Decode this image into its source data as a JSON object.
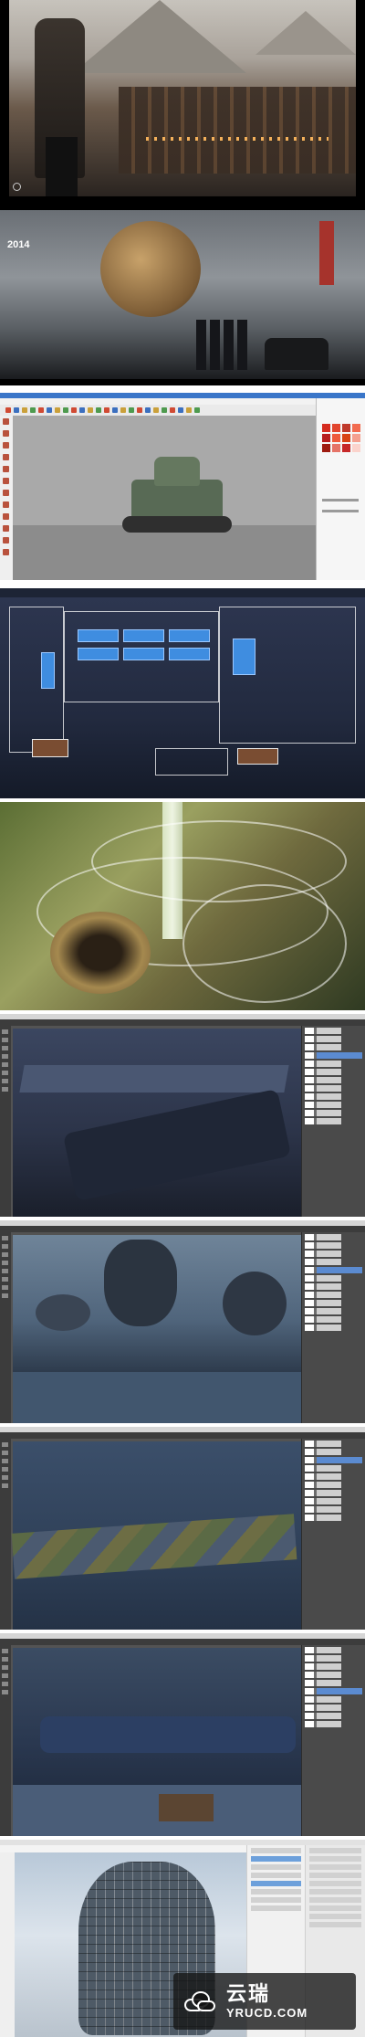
{
  "panels": {
    "zeppelin": {
      "year_label": "2014"
    }
  },
  "watermark": {
    "name_cn": "云瑞",
    "site": "YRUCD.COM"
  },
  "palette": {
    "sketchup_swatches": [
      "#d52b1e",
      "#e2452e",
      "#c0392b",
      "#f26b4f",
      "#b71c1c",
      "#ee5a3c",
      "#d84315",
      "#f4a08f",
      "#9e1b10",
      "#e57367",
      "#c62828",
      "#fbd3cc"
    ]
  }
}
